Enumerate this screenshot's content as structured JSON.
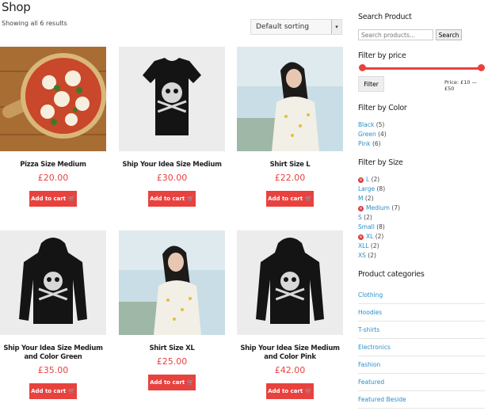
{
  "header": {
    "title": "Shop",
    "results": "Showing all 6 results",
    "sort_value": "Default sorting"
  },
  "products": [
    {
      "title": "Pizza Size Medium",
      "price": "£20.00",
      "button": "Add to cart"
    },
    {
      "title": "Ship Your Idea Size Medium",
      "price": "£30.00",
      "button": "Add to cart"
    },
    {
      "title": "Shirt Size L",
      "price": "£22.00",
      "button": "Add to cart"
    },
    {
      "title": "Ship Your Idea Size Medium and Color Green",
      "price": "£35.00",
      "button": "Add to cart"
    },
    {
      "title": "Shirt Size XL",
      "price": "£25.00",
      "button": "Add to cart"
    },
    {
      "title": "Ship Your Idea Size Medium and Color Pink",
      "price": "£42.00",
      "button": "Add to cart"
    }
  ],
  "sidebar": {
    "search": {
      "heading": "Search Product",
      "placeholder": "Search products...",
      "button": "Search"
    },
    "price": {
      "heading": "Filter by price",
      "button": "Filter",
      "range_text": "Price: £10 — £50"
    },
    "color": {
      "heading": "Filter by Color",
      "items": [
        {
          "label": "Black",
          "count": "(5)"
        },
        {
          "label": "Green",
          "count": "(4)"
        },
        {
          "label": "Pink",
          "count": "(6)"
        }
      ]
    },
    "size": {
      "heading": "Filter by Size",
      "items": [
        {
          "label": "L",
          "count": "(2)",
          "active": true
        },
        {
          "label": "Large",
          "count": "(8)",
          "active": false
        },
        {
          "label": "M",
          "count": "(2)",
          "active": false
        },
        {
          "label": "Medium",
          "count": "(7)",
          "active": true
        },
        {
          "label": "S",
          "count": "(2)",
          "active": false
        },
        {
          "label": "Small",
          "count": "(8)",
          "active": false
        },
        {
          "label": "XL",
          "count": "(2)",
          "active": true
        },
        {
          "label": "XLL",
          "count": "(2)",
          "active": false
        },
        {
          "label": "XS",
          "count": "(2)",
          "active": false
        }
      ]
    },
    "categories": {
      "heading": "Product categories",
      "items": [
        "Clothing",
        "Hoodies",
        "T-shirts",
        "Electronics",
        "Fashion",
        "Featured",
        "Featured Beside"
      ]
    }
  },
  "colors": {
    "accent": "#e8423f",
    "link": "#2a8fc8"
  }
}
